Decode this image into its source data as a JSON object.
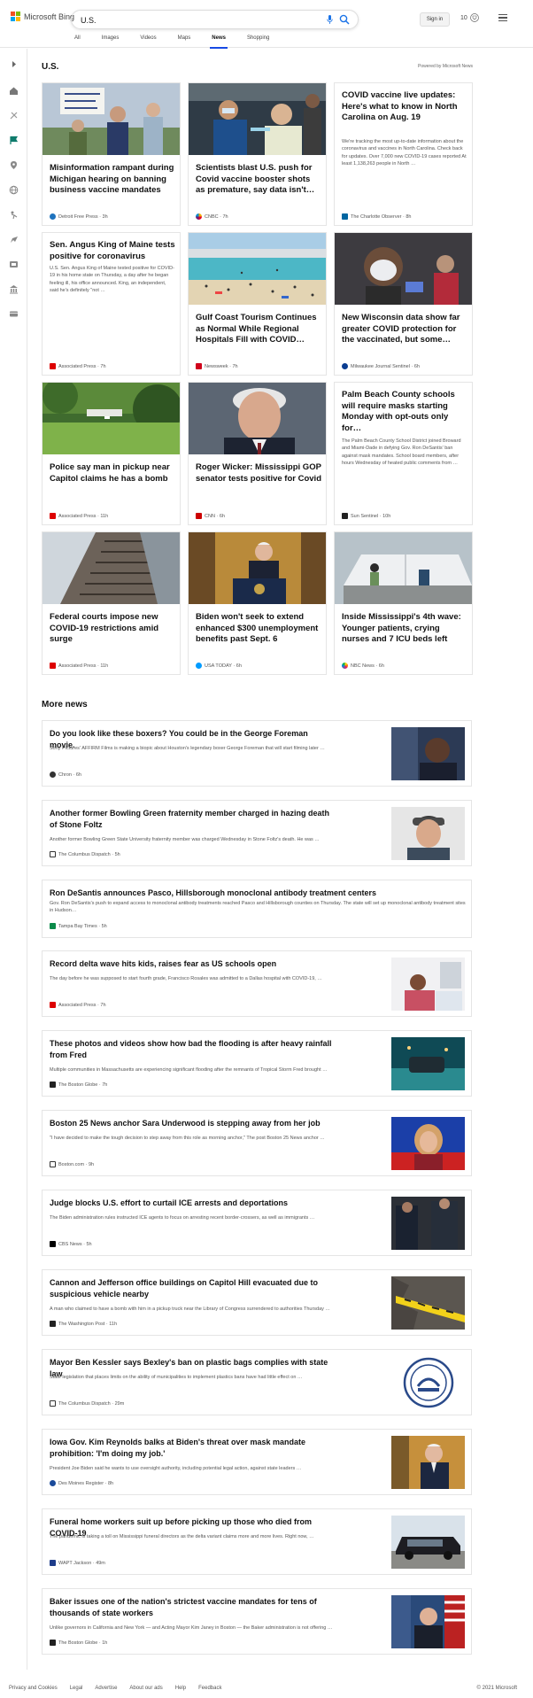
{
  "header": {
    "logo_text": "Microsoft Bing",
    "search_value": "U.S.",
    "signin_label": "Sign in",
    "rewards_count": "10"
  },
  "tabs": [
    {
      "label": "All"
    },
    {
      "label": "Images"
    },
    {
      "label": "Videos"
    },
    {
      "label": "Maps"
    },
    {
      "label": "News",
      "active": true
    },
    {
      "label": "Shopping"
    }
  ],
  "section": {
    "title": "U.S.",
    "powered_by": "Powered by Microsoft News"
  },
  "cards": [
    {
      "title": "Misinformation rampant during Michigan hearing on banning business vaccine mandates",
      "source": "Detroit Free Press",
      "time": "3h"
    },
    {
      "title": "Scientists blast U.S. push for Covid vaccine booster shots as premature, say data isn't…",
      "source": "CNBC",
      "time": "7h"
    },
    {
      "title": "COVID vaccine live updates: Here's what to know in North Carolina on Aug. 19",
      "desc": "We're tracking the most up-to-date information about the coronavirus and vaccines in North Carolina. Check back for updates. Over 7,000 new COVID-19 cases reported At least 1,138,263 people in North …",
      "source": "The Charlotte Observer",
      "time": "8h"
    },
    {
      "title": "Sen. Angus King of Maine tests positive for coronavirus",
      "desc": "U.S. Sen. Angus King of Maine tested positive for COVID-19 in his home state on Thursday, a day after he began feeling ill, his office announced. King, an independent, said he's definitely \"not …",
      "source": "Associated Press",
      "time": "7h"
    },
    {
      "title": "Gulf Coast Tourism Continues as Normal While Regional Hospitals Fill with COVID…",
      "source": "Newsweek",
      "time": "7h"
    },
    {
      "title": "New Wisconsin data show far greater COVID protection for the vaccinated, but some…",
      "source": "Milwaukee Journal Sentinel",
      "time": "6h"
    },
    {
      "title": "Police say man in pickup near Capitol claims he has a bomb",
      "source": "Associated Press",
      "time": "11h"
    },
    {
      "title": "Roger Wicker: Mississippi GOP senator tests positive for Covid",
      "source": "CNN",
      "time": "6h"
    },
    {
      "title": "Palm Beach County schools will require masks starting Monday with opt-outs only for…",
      "desc": "The Palm Beach County School District joined Broward and Miami-Dade in defying Gov. Ron DeSantis' ban against mask mandates. School board members, after hours Wednesday of heated public comments from …",
      "source": "Sun Sentinel",
      "time": "10h"
    },
    {
      "title": "Federal courts impose new COVID-19 restrictions amid surge",
      "source": "Associated Press",
      "time": "11h"
    },
    {
      "title": "Biden won't seek to extend enhanced $300 unemployment benefits past Sept. 6",
      "source": "USA TODAY",
      "time": "6h"
    },
    {
      "title": "Inside Mississippi's 4th wave: Younger patients, crying nurses and 7 ICU beds left",
      "source": "NBC News",
      "time": "6h"
    }
  ],
  "more_news": {
    "title": "More news",
    "items": [
      {
        "title": "Do you look like these boxers? You could be in the George Foreman movie.",
        "desc": "Sony Pictures' AFFIRM Films is making a biopic about Houston's legendary boxer George Foreman that will start filming later …",
        "source": "Chron",
        "time": "6h"
      },
      {
        "title": "Another former Bowling Green fraternity member charged in hazing death of Stone Foltz",
        "desc": "Another former Bowling Green State University fraternity member was charged Wednesday in Stone Foltz's death. He was …",
        "source": "The Columbus Dispatch",
        "time": "5h"
      },
      {
        "title": "Ron DeSantis announces Pasco, Hillsborough monoclonal antibody treatment centers",
        "desc": "Gov. Ron DeSantis's push to expand access to monoclonal antibody treatments reached Pasco and Hillsborough counties on Thursday. The state will set up monoclonal antibody treatment sites in Hudson…",
        "source": "Tampa Bay Times",
        "time": "5h"
      },
      {
        "title": "Record delta wave hits kids, raises fear as US schools open",
        "desc": "The day before he was supposed to start fourth grade, Francisco Rosales was admitted to a Dallas hospital with COVID-19, …",
        "source": "Associated Press",
        "time": "7h"
      },
      {
        "title": "These photos and videos show how bad the flooding is after heavy rainfall from Fred",
        "desc": "Multiple communities in Massachusetts are experiencing significant flooding after the remnants of Tropical Storm Fred brought …",
        "source": "The Boston Globe",
        "time": "7h"
      },
      {
        "title": "Boston 25 News anchor Sara Underwood is stepping away from her job",
        "desc": "\"I have decided to make the tough decision to step away from this role as morning anchor,\" The post Boston 25 News anchor …",
        "source": "Boston.com",
        "time": "9h"
      },
      {
        "title": "Judge blocks U.S. effort to curtail ICE arrests and deportations",
        "desc": "The Biden administration rules instructed ICE agents to focus on arresting recent border-crossers, as well as immigrants …",
        "source": "CBS News",
        "time": "5h"
      },
      {
        "title": "Cannon and Jefferson office buildings on Capitol Hill evacuated due to suspicious vehicle nearby",
        "desc": "A man who claimed to have a bomb with him in a pickup truck near the Library of Congress surrendered to authorities Thursday …",
        "source": "The Washington Post",
        "time": "11h"
      },
      {
        "title": "Mayor Ben Kessler says Bexley's ban on plastic bags complies with state law",
        "desc": "State legislation that places limits on the ability of municipalities to implement plastics bans have had little effect on …",
        "source": "The Columbus Dispatch",
        "time": "29m"
      },
      {
        "title": "Iowa Gov. Kim Reynolds balks at Biden's threat over mask mandate prohibition: 'I'm doing my job.'",
        "desc": "President Joe Biden said he wants to use oversight authority, including potential legal action, against state leaders …",
        "source": "Des Moines Register",
        "time": "8h"
      },
      {
        "title": "Funeral home workers suit up before picking up those who died from COVID-19",
        "desc": "The pandemic is taking a toll on Mississippi funeral directors as the delta variant claims more and more lives. Right now, …",
        "source": "WAPT Jackson",
        "time": "49m"
      },
      {
        "title": "Baker issues one of the nation's strictest vaccine mandates for tens of thousands of state workers",
        "desc": "Unlike governors in California and New York — and Acting Mayor Kim Janey in Boston — the Baker administration is not offering …",
        "source": "The Boston Globe",
        "time": "1h"
      }
    ]
  },
  "footer": {
    "links": [
      "Privacy and Cookies",
      "Legal",
      "Advertise",
      "About our ads",
      "Help",
      "Feedback"
    ],
    "copyright": "© 2021 Microsoft"
  },
  "colors": {
    "accent": "#174ae4",
    "search_icon": "#1a73e8"
  }
}
